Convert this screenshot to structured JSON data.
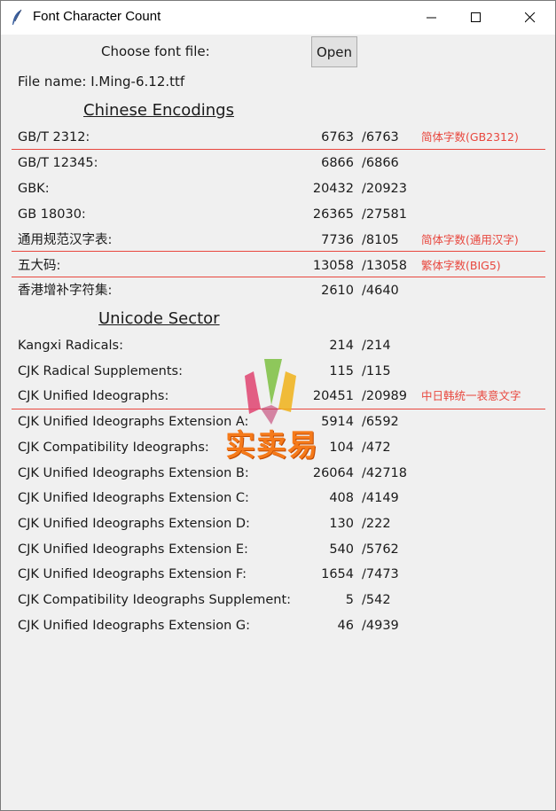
{
  "window": {
    "title": "Font Character Count"
  },
  "file": {
    "choose_label": "Choose font file:",
    "open_button": "Open",
    "name_label": "File name: I.Ming-6.12.ttf"
  },
  "sections": {
    "chinese": "Chinese Encodings",
    "unicode": "Unicode Sector"
  },
  "chinese_rows": [
    {
      "label": "GB/T 2312:",
      "count": "6763",
      "total": "/6763",
      "note": "简体字数(GB2312)"
    },
    {
      "label": "GB/T 12345:",
      "count": "6866",
      "total": "/6866",
      "note": ""
    },
    {
      "label": "GBK:",
      "count": "20432",
      "total": "/20923",
      "note": ""
    },
    {
      "label": "GB 18030:",
      "count": "26365",
      "total": "/27581",
      "note": ""
    },
    {
      "label": "通用规范汉字表:",
      "count": "7736",
      "total": "/8105",
      "note": "简体字数(通用汉字)"
    },
    {
      "label": "五大码:",
      "count": "13058",
      "total": "/13058",
      "note": "繁体字数(BIG5)"
    },
    {
      "label": "香港增补字符集:",
      "count": "2610",
      "total": "/4640",
      "note": ""
    }
  ],
  "unicode_rows": [
    {
      "label": "Kangxi Radicals:",
      "count": "214",
      "total": "/214",
      "note": ""
    },
    {
      "label": "CJK Radical Supplements:",
      "count": "115",
      "total": "/115",
      "note": ""
    },
    {
      "label": "CJK Unified Ideographs:",
      "count": "20451",
      "total": "/20989",
      "note": "中日韩统一表意文字"
    },
    {
      "label": "CJK Unified Ideographs Extension A:",
      "count": "5914",
      "total": "/6592",
      "note": ""
    },
    {
      "label": "CJK Compatibility Ideographs:",
      "count": "104",
      "total": "/472",
      "note": ""
    },
    {
      "label": "CJK Unified Ideographs Extension B:",
      "count": "26064",
      "total": "/42718",
      "note": ""
    },
    {
      "label": "CJK Unified Ideographs Extension C:",
      "count": "408",
      "total": "/4149",
      "note": ""
    },
    {
      "label": "CJK Unified Ideographs Extension D:",
      "count": "130",
      "total": "/222",
      "note": ""
    },
    {
      "label": "CJK Unified Ideographs Extension E:",
      "count": "540",
      "total": "/5762",
      "note": ""
    },
    {
      "label": "CJK Unified Ideographs Extension F:",
      "count": "1654",
      "total": "/7473",
      "note": ""
    },
    {
      "label": "CJK Compatibility Ideographs Supplement:",
      "count": "5",
      "total": "/542",
      "note": ""
    },
    {
      "label": "CJK Unified Ideographs Extension G:",
      "count": "46",
      "total": "/4939",
      "note": ""
    }
  ],
  "watermark": {
    "text": "实卖易"
  },
  "colors": {
    "accent_red": "#e8473e"
  }
}
